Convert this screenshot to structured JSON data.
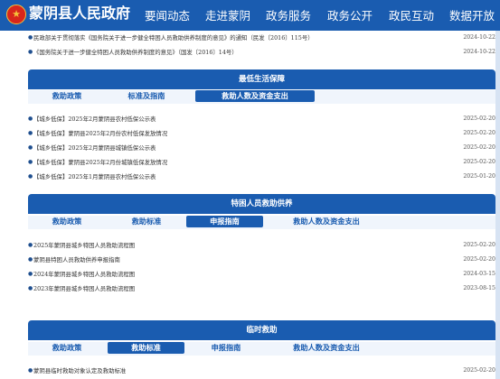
{
  "header": {
    "site_title": "蒙阴县人民政府",
    "nav": [
      "要闻动态",
      "走进蒙阴",
      "政务服务",
      "政务公开",
      "政民互动",
      "数据开放"
    ]
  },
  "top_list": [
    {
      "title": "民政部关于贯彻落实《国务院关于进一步健全特困人员救助供养制度的意见》的通知（民发〔2016〕115号）",
      "date": "2024-10-22"
    },
    {
      "title": "《国务院关于进一步健全特困人员救助供养制度的意见》（国发〔2016〕14号）",
      "date": "2024-10-22"
    }
  ],
  "sections": [
    {
      "title": "最低生活保障",
      "tabs": [
        "救助政策",
        "标准及指南",
        "救助人数及资金支出"
      ],
      "active_tab": 2,
      "items": [
        {
          "title": "【城乡低保】2025年2月蒙阴县农村低保公示表",
          "date": "2025-02-20"
        },
        {
          "title": "【城乡低保】蒙阴县2025年2月份农村低保发放情况",
          "date": "2025-02-20"
        },
        {
          "title": "【城乡低保】2025年2月蒙阴县城镇低保公示表",
          "date": "2025-02-20"
        },
        {
          "title": "【城乡低保】蒙阴县2025年2月份城镇低保发放情况",
          "date": "2025-02-20"
        },
        {
          "title": "【城乡低保】2025年1月蒙阴县农村低保公示表",
          "date": "2025-01-20"
        }
      ]
    },
    {
      "title": "特困人员救助供养",
      "tabs": [
        "救助政策",
        "救助标准",
        "申报指南",
        "救助人数及资金支出"
      ],
      "active_tab": 2,
      "items": [
        {
          "title": "2025年蒙阴县城乡特困人员救助流程图",
          "date": "2025-02-20"
        },
        {
          "title": "蒙阴县特困人员救助供养申报指南",
          "date": "2025-02-20"
        },
        {
          "title": "2024年蒙阴县城乡特困人员救助流程图",
          "date": "2024-03-15"
        },
        {
          "title": "2023年蒙阴县城乡特困人员救助流程图",
          "date": "2023-08-15"
        }
      ]
    },
    {
      "title": "临时救助",
      "tabs": [
        "救助政策",
        "救助标准",
        "申报指南",
        "救助人数及资金支出"
      ],
      "active_tab": 1,
      "items": [
        {
          "title": "蒙阴县临时救助对象认定及救助标准",
          "date": "2025-02-20"
        }
      ]
    }
  ],
  "colors": {
    "brand": "#1a5cb0",
    "emblem": "#d8261c"
  }
}
